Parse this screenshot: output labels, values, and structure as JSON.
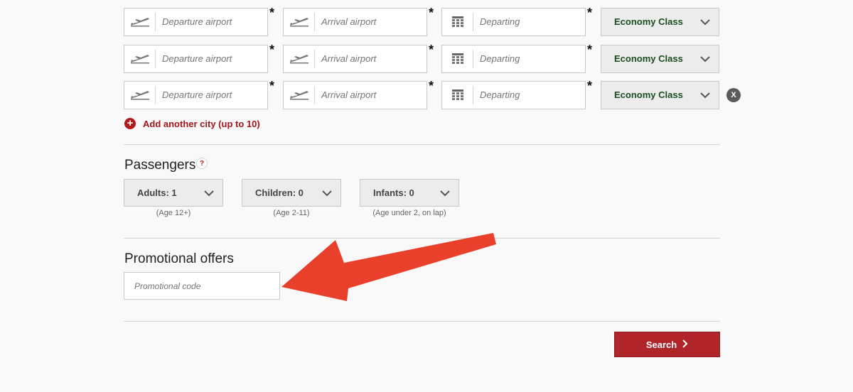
{
  "flights": [
    {
      "departure_placeholder": "Departure airport",
      "arrival_placeholder": "Arrival airport",
      "date_placeholder": "Departing",
      "required_mark": "*",
      "cabin_class": "Economy Class"
    },
    {
      "departure_placeholder": "Departure airport",
      "arrival_placeholder": "Arrival airport",
      "date_placeholder": "Departing",
      "required_mark": "*",
      "cabin_class": "Economy Class"
    },
    {
      "departure_placeholder": "Departure airport",
      "arrival_placeholder": "Arrival airport",
      "date_placeholder": "Departing",
      "required_mark": "*",
      "cabin_class": "Economy Class",
      "remove_label": "X"
    }
  ],
  "add_city": {
    "icon": "+",
    "label": "Add another city (up to 10)"
  },
  "passengers": {
    "title": "Passengers",
    "help_icon": "?",
    "adults": {
      "label": "Adults: 1",
      "note": "(Age 12+)"
    },
    "children": {
      "label": "Children: 0",
      "note": "(Age 2-11)"
    },
    "infants": {
      "label": "Infants: 0",
      "note": "(Age under 2, on lap)"
    }
  },
  "promo": {
    "title": "Promotional offers",
    "placeholder": "Promotional code"
  },
  "search_button": {
    "label": "Search"
  },
  "colors": {
    "accent": "#b0252a",
    "link": "#a4161a",
    "class_text": "#1b4d1f",
    "annotation_arrow": "#e8402b"
  }
}
